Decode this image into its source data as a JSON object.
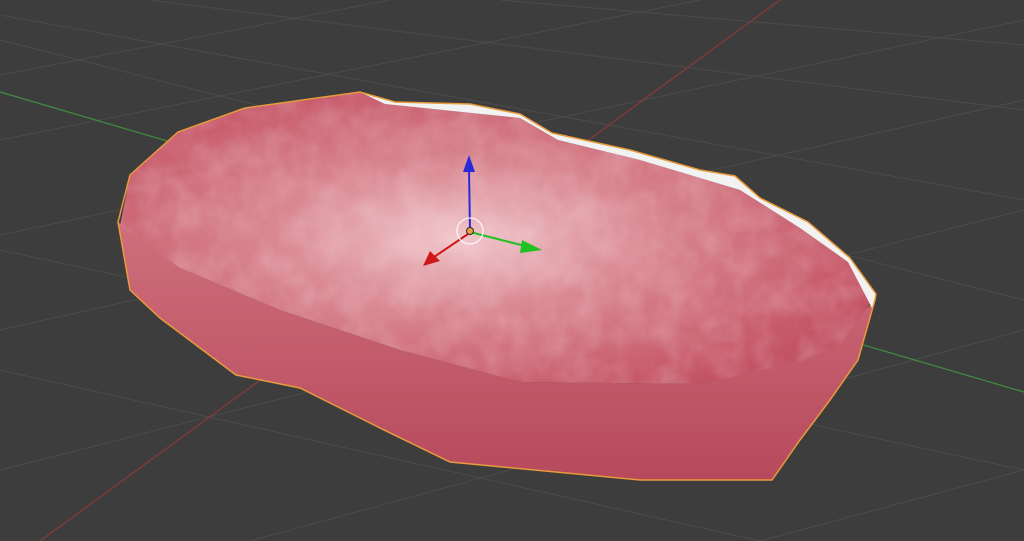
{
  "viewport": {
    "background_color": "#3d3d3d",
    "grid_color": "#4a4a4a",
    "x_axis_line_color": "#8a3a3a",
    "y_axis_line_color": "#3f8f3f"
  },
  "object": {
    "kind": "steak-mesh",
    "selected": true,
    "outline_color": "#e89a3c",
    "texture_colors": [
      "#c75a6a",
      "#d98892",
      "#b8475a",
      "#eab6bc"
    ],
    "fat_edge_color": "#f2f2f2"
  },
  "gizmo": {
    "mode": "translate",
    "z_axis_color": "#2a2ad8",
    "y_axis_color": "#22c022",
    "x_axis_color": "#d01818",
    "origin_color": "#e8a040"
  }
}
